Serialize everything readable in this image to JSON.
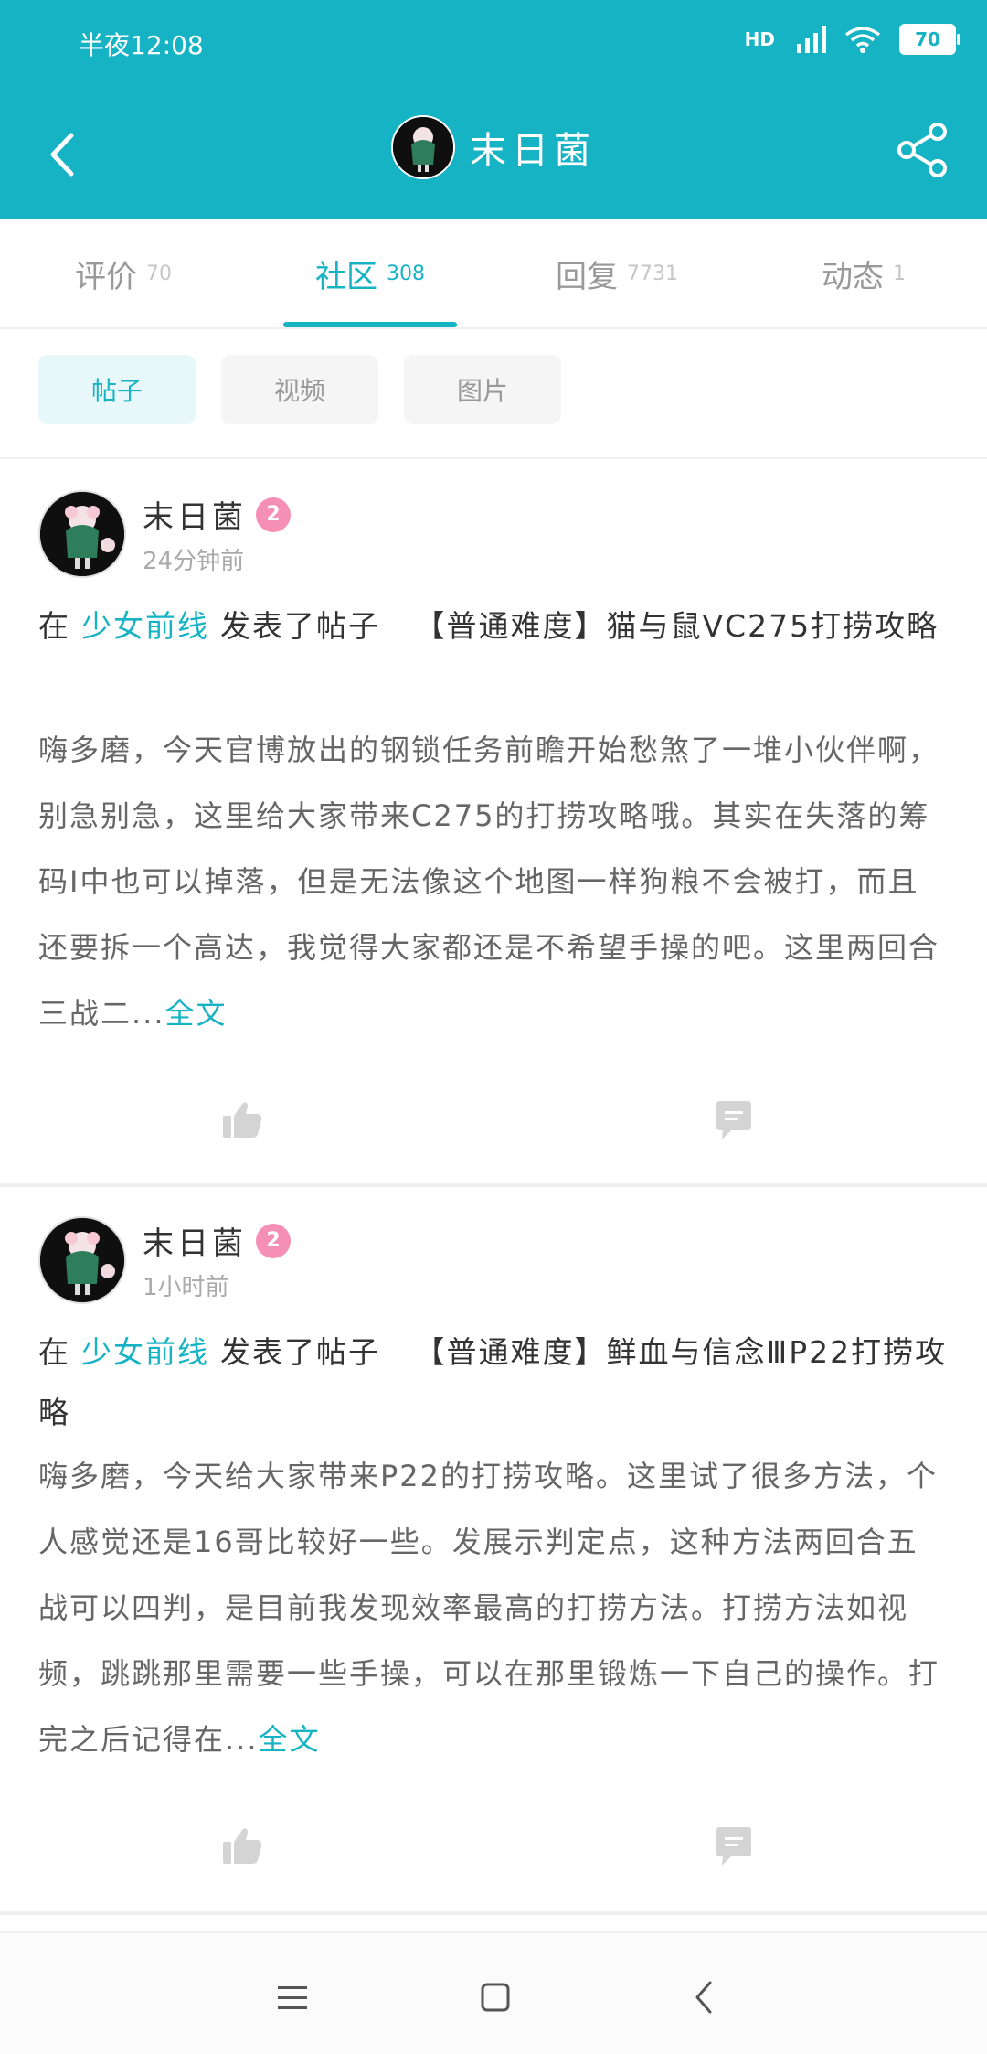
{
  "status_bar": {
    "time": "半夜12:08",
    "network_badge": "HD",
    "battery": "70"
  },
  "header": {
    "title": "末日菌",
    "back_icon": "back-arrow-icon",
    "share_icon": "share-icon"
  },
  "tabs": [
    {
      "label": "评价",
      "count": "70"
    },
    {
      "label": "社区",
      "count": "308"
    },
    {
      "label": "回复",
      "count": "7731"
    },
    {
      "label": "动态",
      "count": "1"
    }
  ],
  "filters": [
    "帖子",
    "视频",
    "图片"
  ],
  "posts": [
    {
      "username": "末日菌",
      "level": "2",
      "time": "24分钟前",
      "prefix": "在",
      "game": "少女前线",
      "action": "发表了帖子",
      "title": "【普通难度】猫与鼠ⅤC275打捞攻略",
      "body": "嗨多磨，今天官博放出的钢锁任务前瞻开始愁煞了一堆小伙伴啊，别急别急，这里给大家带来C275的打捞攻略哦。其实在失落的筹码Ⅰ中也可以掉落，但是无法像这个地图一样狗粮不会被打，而且还要拆一个高达，我觉得大家都还是不希望手操的吧。这里两回合三战二...",
      "more": "全文"
    },
    {
      "username": "末日菌",
      "level": "2",
      "time": "1小时前",
      "prefix": "在",
      "game": "少女前线",
      "action": "发表了帖子",
      "title": "【普通难度】鲜血与信念ⅢP22打捞攻略",
      "body": "嗨多磨，今天给大家带来P22的打捞攻略。这里试了很多方法，个人感觉还是16哥比较好一些。发展示判定点，这种方法两回合五战可以四判，是目前我发现效率最高的打捞方法。打捞方法如视频，跳跳那里需要一些手操，可以在那里锻炼一下自己的操作。打完之后记得在...",
      "more": "全文"
    }
  ],
  "colors": {
    "accent": "#16b3c4",
    "badge": "#f58fb4"
  }
}
